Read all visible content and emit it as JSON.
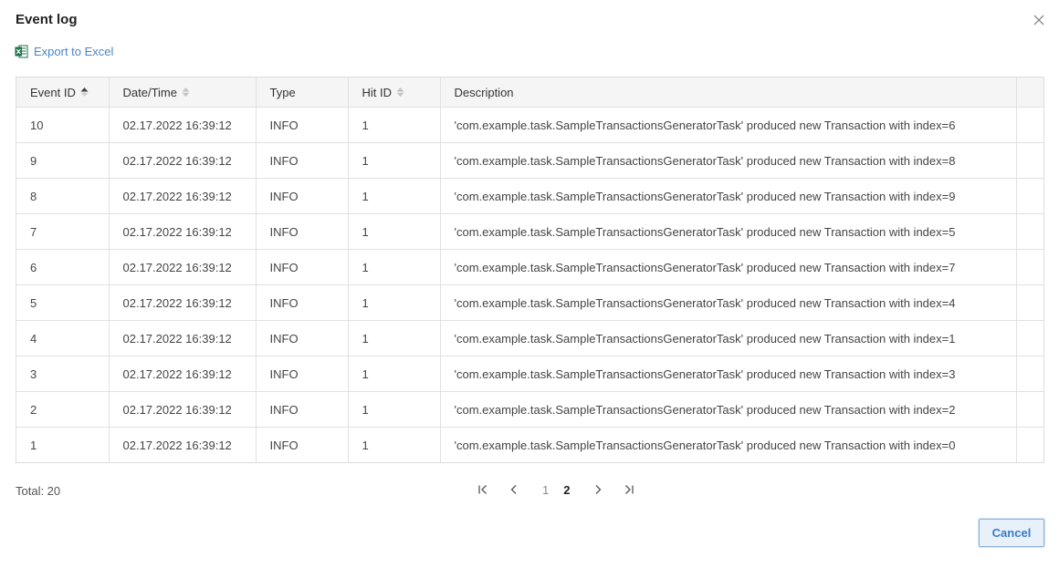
{
  "dialog": {
    "title": "Event log"
  },
  "toolbar": {
    "export_label": "Export to Excel"
  },
  "table": {
    "columns": [
      {
        "label": "Event ID",
        "sort": "asc"
      },
      {
        "label": "Date/Time",
        "sort": "none"
      },
      {
        "label": "Type",
        "sort": ""
      },
      {
        "label": "Hit ID",
        "sort": "none"
      },
      {
        "label": "Description",
        "sort": ""
      }
    ],
    "rows": [
      {
        "event_id": "10",
        "datetime": "02.17.2022 16:39:12",
        "type": "INFO",
        "hit_id": "1",
        "description": "'com.example.task.SampleTransactionsGeneratorTask' produced new Transaction with index=6"
      },
      {
        "event_id": "9",
        "datetime": "02.17.2022 16:39:12",
        "type": "INFO",
        "hit_id": "1",
        "description": "'com.example.task.SampleTransactionsGeneratorTask' produced new Transaction with index=8"
      },
      {
        "event_id": "8",
        "datetime": "02.17.2022 16:39:12",
        "type": "INFO",
        "hit_id": "1",
        "description": "'com.example.task.SampleTransactionsGeneratorTask' produced new Transaction with index=9"
      },
      {
        "event_id": "7",
        "datetime": "02.17.2022 16:39:12",
        "type": "INFO",
        "hit_id": "1",
        "description": "'com.example.task.SampleTransactionsGeneratorTask' produced new Transaction with index=5"
      },
      {
        "event_id": "6",
        "datetime": "02.17.2022 16:39:12",
        "type": "INFO",
        "hit_id": "1",
        "description": "'com.example.task.SampleTransactionsGeneratorTask' produced new Transaction with index=7"
      },
      {
        "event_id": "5",
        "datetime": "02.17.2022 16:39:12",
        "type": "INFO",
        "hit_id": "1",
        "description": "'com.example.task.SampleTransactionsGeneratorTask' produced new Transaction with index=4"
      },
      {
        "event_id": "4",
        "datetime": "02.17.2022 16:39:12",
        "type": "INFO",
        "hit_id": "1",
        "description": "'com.example.task.SampleTransactionsGeneratorTask' produced new Transaction with index=1"
      },
      {
        "event_id": "3",
        "datetime": "02.17.2022 16:39:12",
        "type": "INFO",
        "hit_id": "1",
        "description": "'com.example.task.SampleTransactionsGeneratorTask' produced new Transaction with index=3"
      },
      {
        "event_id": "2",
        "datetime": "02.17.2022 16:39:12",
        "type": "INFO",
        "hit_id": "1",
        "description": "'com.example.task.SampleTransactionsGeneratorTask' produced new Transaction with index=2"
      },
      {
        "event_id": "1",
        "datetime": "02.17.2022 16:39:12",
        "type": "INFO",
        "hit_id": "1",
        "description": "'com.example.task.SampleTransactionsGeneratorTask' produced new Transaction with index=0"
      }
    ]
  },
  "footer": {
    "total_label": "Total: 20",
    "pages": [
      "1",
      "2"
    ],
    "current_page": "2",
    "cancel_label": "Cancel"
  },
  "icons": {
    "close": "close-icon",
    "export": "excel-icon",
    "first": "first-page-icon",
    "prev": "prev-page-icon",
    "next": "next-page-icon",
    "last": "last-page-icon"
  },
  "colors": {
    "link": "#4a86c5",
    "excel_green": "#1d7044",
    "button_border": "#8bb3dc",
    "button_bg": "#e8f0f9",
    "header_bg": "#f5f5f5"
  }
}
